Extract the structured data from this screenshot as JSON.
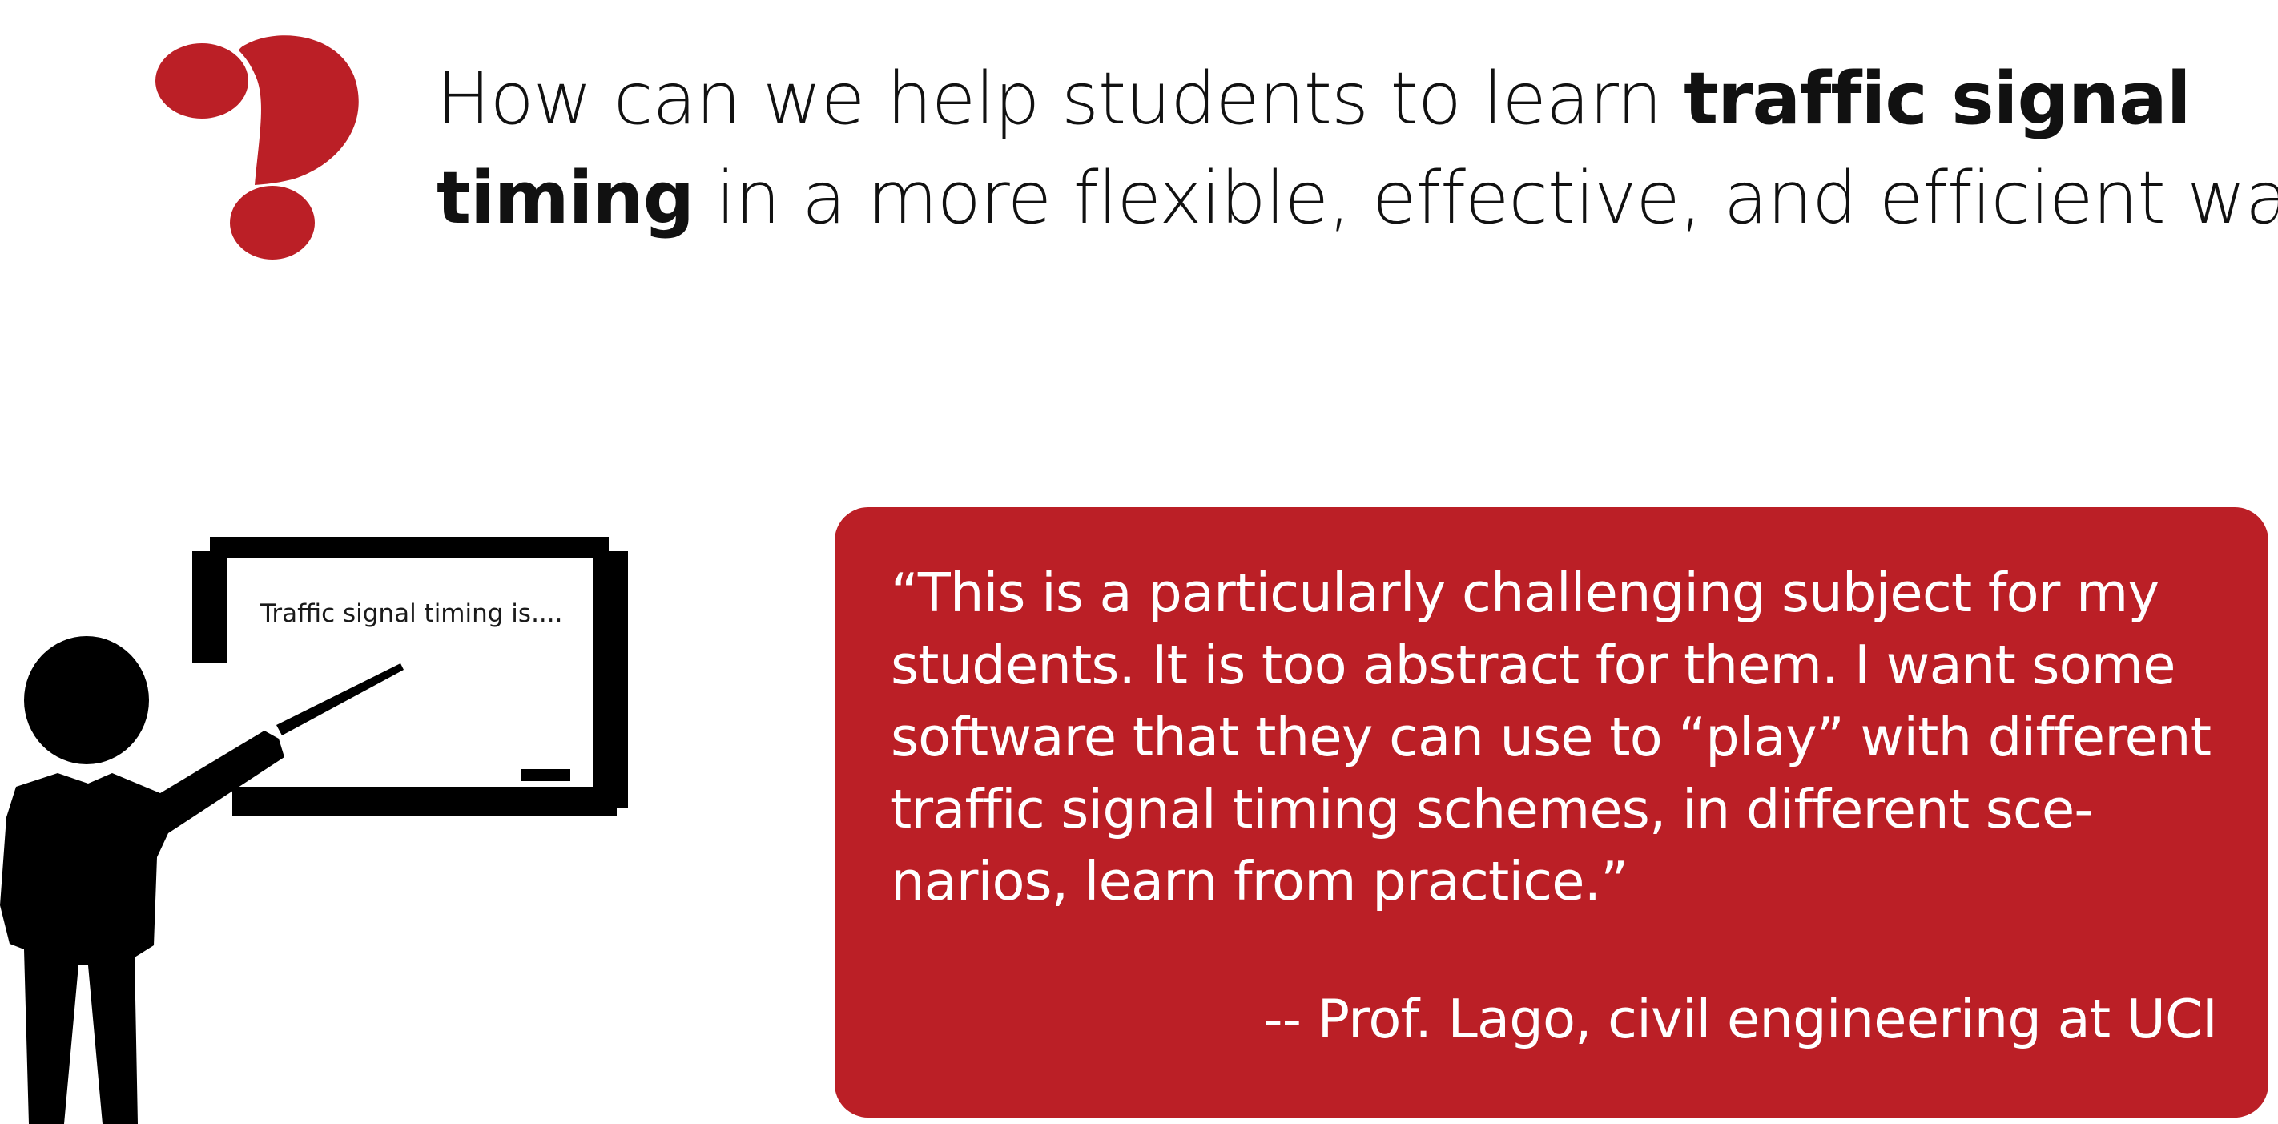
{
  "colors": {
    "accent": "#bb1f26",
    "text": "#111111",
    "icon": "#000000"
  },
  "icons": {
    "question_mark": "question-mark-icon",
    "teacher": "teacher-at-board-icon"
  },
  "headline": {
    "line1_prefix": "How can we help students to learn ",
    "line1_bold": "traffic signal",
    "line2_bold": "timing",
    "line2_suffix": " in a more flexible, effective, and efficient way?"
  },
  "board": {
    "text": "Traffic signal timing is...."
  },
  "quote": {
    "lines": [
      "“This is a particularly challenging subject for my",
      "students. It is too abstract for them. I want some",
      "software that they can use to “play” with different",
      "traffic signal timing schemes, in different sce-",
      "narios, learn from practice.”"
    ],
    "attribution": "-- Prof. Lago, civil engineering at UCI"
  }
}
